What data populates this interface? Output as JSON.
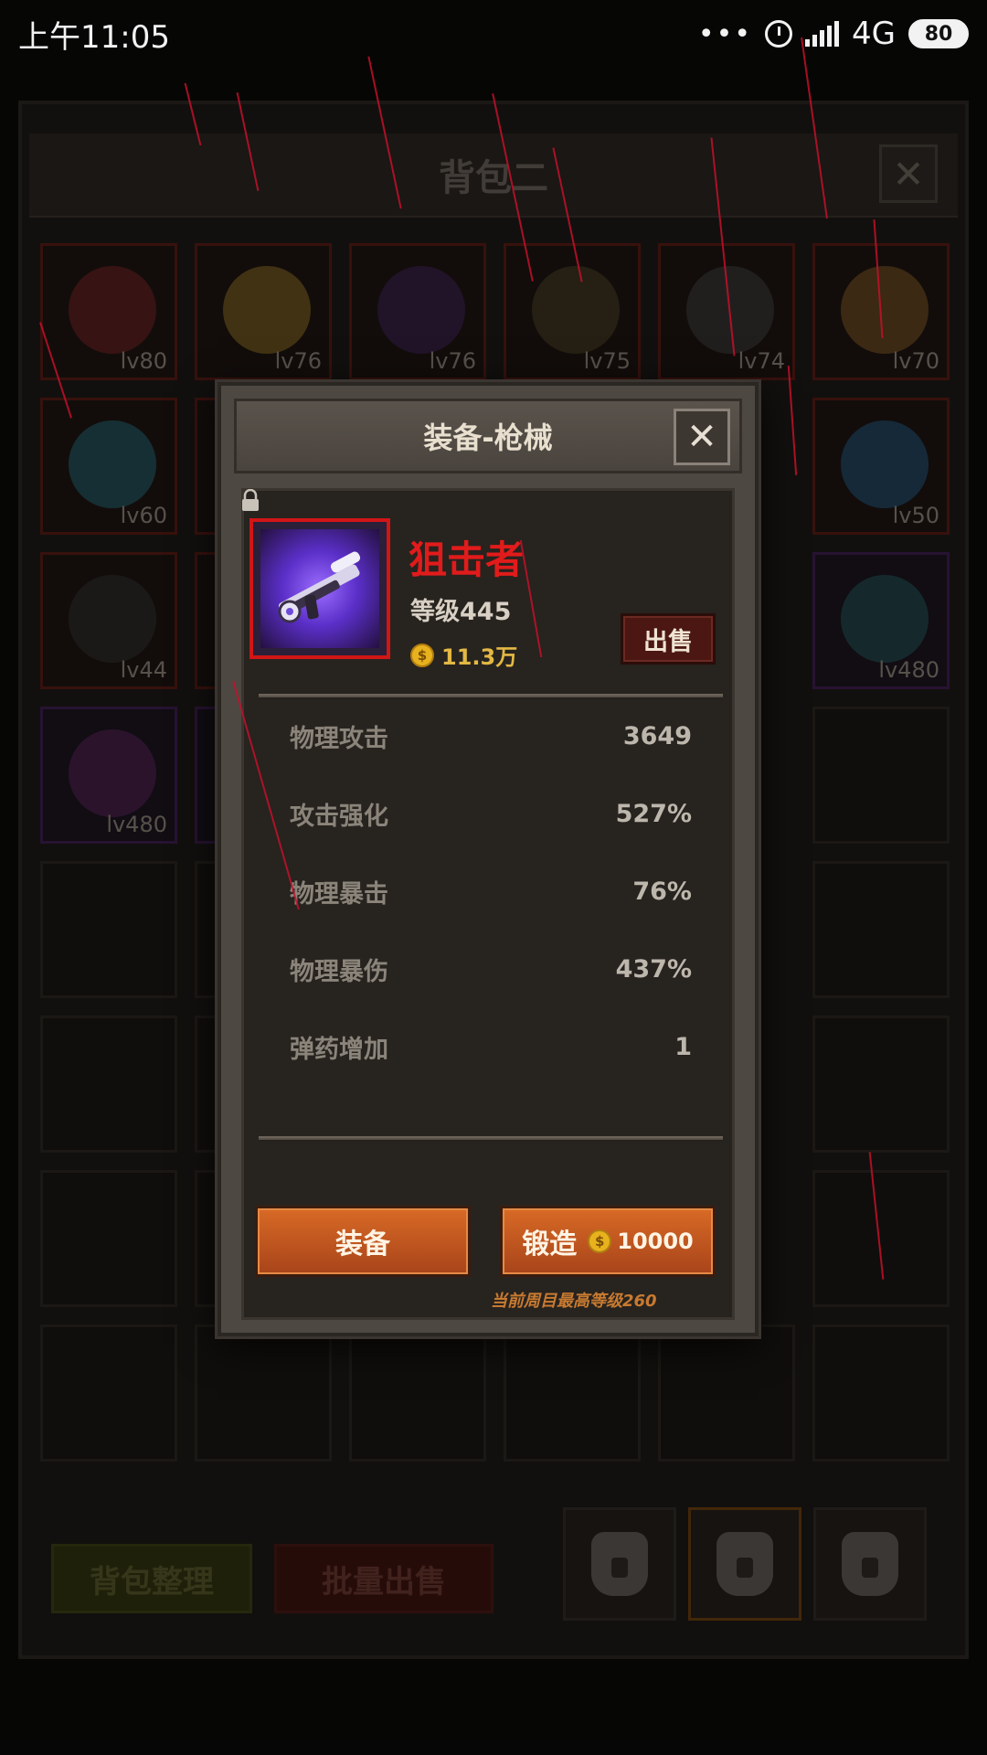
{
  "status_bar": {
    "time": "上午11:05",
    "network": "4G",
    "battery": "80"
  },
  "bag": {
    "title": "背包二",
    "close_label": "✕",
    "items": [
      {
        "level": "lv80",
        "rarity": "red",
        "icon": "ruby-amulet-icon",
        "color": "#8a2a2a"
      },
      {
        "level": "lv76",
        "rarity": "red",
        "icon": "gold-ring-icon",
        "color": "#a9832c"
      },
      {
        "level": "lv76",
        "rarity": "red",
        "icon": "purple-hood-icon",
        "color": "#4a2a6a"
      },
      {
        "level": "lv75",
        "rarity": "red",
        "icon": "dark-horn-icon",
        "color": "#5a4a2a"
      },
      {
        "level": "lv74",
        "rarity": "red",
        "icon": "iron-ring-icon",
        "color": "#4a4a4a"
      },
      {
        "level": "lv70",
        "rarity": "red",
        "icon": "gold-jewel-ring-icon",
        "color": "#9a6a2a"
      },
      {
        "level": "lv60",
        "rarity": "red",
        "icon": "crystal-pendant-icon",
        "color": "#2a7a8a"
      },
      {
        "level": "",
        "rarity": "red",
        "icon": "item-icon",
        "color": "#6a4a2a"
      },
      {
        "level": "lv50",
        "rarity": "red",
        "icon": "blue-orb-icon",
        "color": "#2a6a9a"
      },
      {
        "level": "lv44",
        "rarity": "red",
        "icon": "black-ring-icon",
        "color": "#3a3a3a"
      },
      {
        "level": "",
        "rarity": "red",
        "icon": "item-icon",
        "color": "#6a4a2a"
      },
      {
        "level": "lv480",
        "rarity": "purple",
        "icon": "teal-sphere-icon",
        "color": "#2a6a6a"
      },
      {
        "level": "lv480",
        "rarity": "purple",
        "icon": "purple-flame-icon",
        "color": "#6a2a6a"
      }
    ],
    "sort_label": "背包整理",
    "batch_sell_label": "批量出售"
  },
  "modal": {
    "title": "装备-枪械",
    "close_label": "✕",
    "item": {
      "name": "狙击者",
      "level": "等级445",
      "price": "11.3万",
      "icon": "sniper-rifle-icon",
      "frame_color": "#d11616"
    },
    "sell_label": "出售",
    "stats": [
      {
        "name": "物理攻击",
        "value": "3649"
      },
      {
        "name": "攻击强化",
        "value": "527%"
      },
      {
        "name": "物理暴击",
        "value": "76%"
      },
      {
        "name": "物理暴伤",
        "value": "437%"
      },
      {
        "name": "弹药增加",
        "value": "1"
      }
    ],
    "equip_label": "装备",
    "forge_label": "锻造",
    "forge_cost": "10000",
    "forge_note": "当前周目最高等级260"
  },
  "colors": {
    "accent_orange": "#d86a26",
    "name_red": "#e11b1b",
    "gold": "#e3b844",
    "rain_red": "#c4112a"
  }
}
